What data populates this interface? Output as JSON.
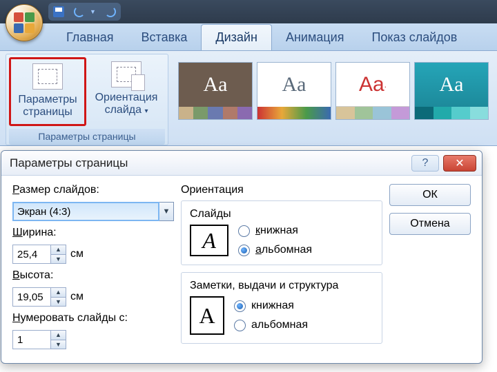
{
  "qat": {
    "save_icon": "save-icon",
    "undo_icon": "undo-icon",
    "redo_icon": "redo-icon"
  },
  "tabs": {
    "items": [
      {
        "label": "Главная"
      },
      {
        "label": "Вставка"
      },
      {
        "label": "Дизайн"
      },
      {
        "label": "Анимация"
      },
      {
        "label": "Показ слайдов"
      }
    ],
    "active_index": 2
  },
  "ribbon": {
    "group_label": "Параметры страницы",
    "page_setup_btn": "Параметры\nстраницы",
    "orientation_btn": "Ориентация\nслайда",
    "themes": {
      "sample_text": "Aa",
      "sample_text_sup": "Aa·"
    }
  },
  "dialog": {
    "title": "Параметры страницы",
    "help": "?",
    "close": "✕",
    "size_label": "Размер слайдов:",
    "size_value": "Экран (4:3)",
    "width_label": "Ширина:",
    "width_value": "25,4",
    "height_label": "Высота:",
    "height_value": "19,05",
    "unit": "см",
    "numfrom_label": "Нумеровать слайды с:",
    "numfrom_value": "1",
    "orientation_heading": "Ориентация",
    "slides_legend": "Слайды",
    "notes_legend": "Заметки, выдачи и структура",
    "portrait": "книжная",
    "landscape": "альбомная",
    "slides_selected": "landscape",
    "notes_selected": "portrait",
    "preview_letter": "A",
    "ok": "ОК",
    "cancel": "Отмена"
  }
}
